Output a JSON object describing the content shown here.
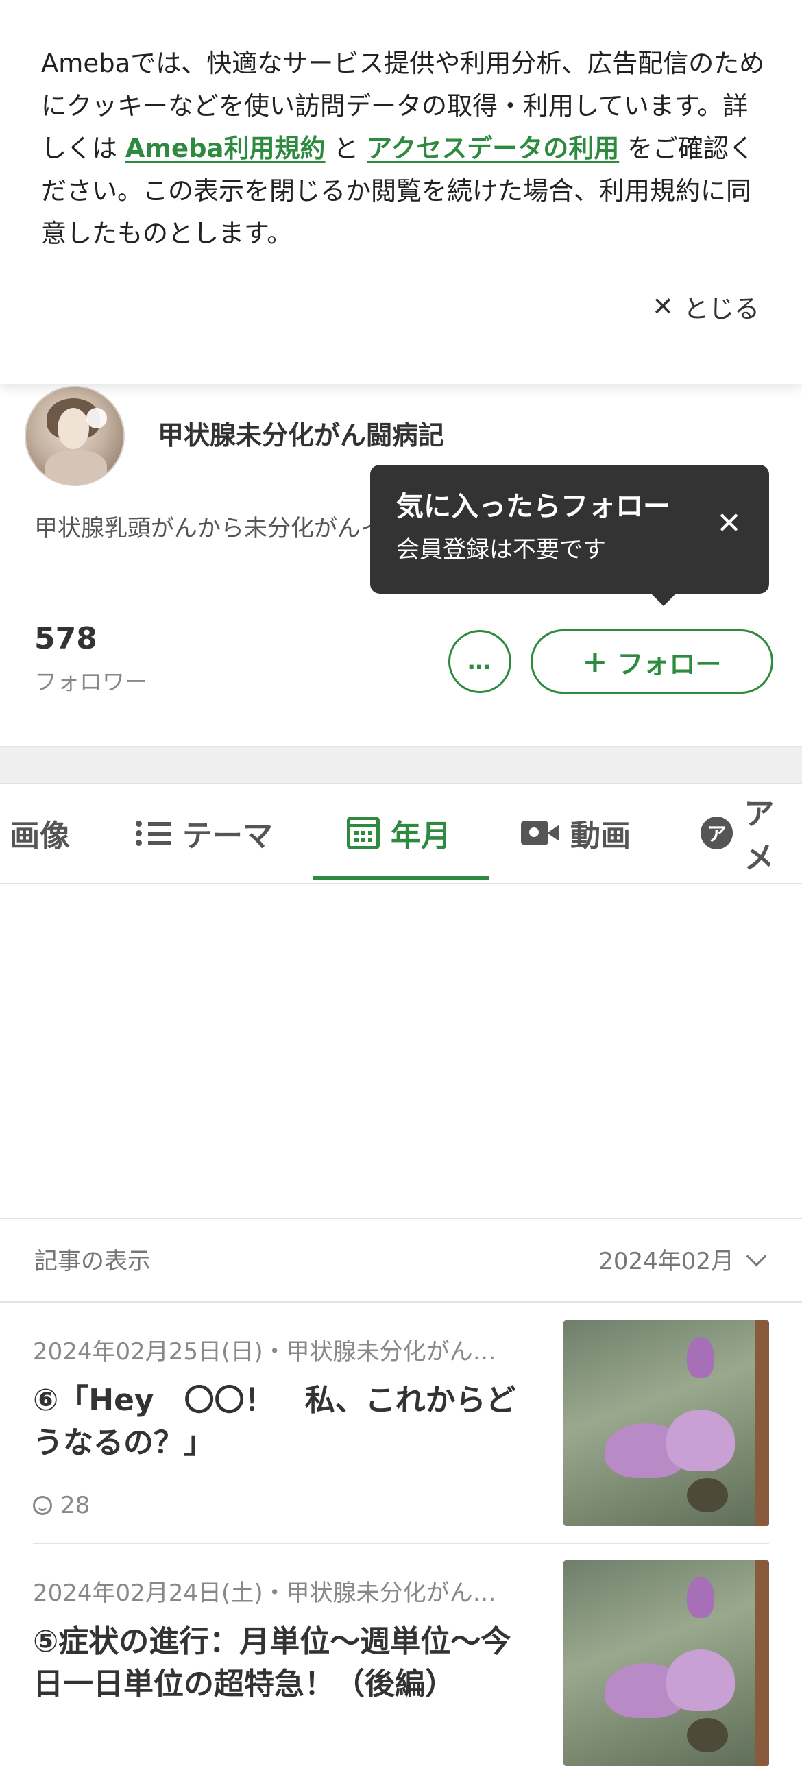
{
  "cookie_banner": {
    "text_part1": "Amebaでは、快適なサービス提供や利用分析、広告配信のためにクッキーなどを使い訪問データの取得・利用しています。詳しくは ",
    "link1": "Ameba利用規約",
    "text_mid": " と ",
    "link2": "アクセスデータの利用",
    "text_part2": " をご確認ください。この表示を閉じるか閲覧を続けた場合、利用規約に同意したものとします。",
    "close_label": "とじる"
  },
  "profile": {
    "blog_title": "甲状腺未分化がん闘病記",
    "description": "甲状腺乳頭がんから未分化がんイバーのリアルながん情報を生",
    "follower_count": "578",
    "follower_label": "フォロワー",
    "more_label": "…",
    "follow_label": "フォロー"
  },
  "tooltip": {
    "title": "気に入ったらフォロー",
    "subtitle": "会員登録は不要です"
  },
  "tabs": [
    {
      "label": "画像",
      "icon": "image-icon"
    },
    {
      "label": "テーマ",
      "icon": "list-icon"
    },
    {
      "label": "年月",
      "icon": "calendar-icon"
    },
    {
      "label": "動画",
      "icon": "video-icon"
    },
    {
      "label": "アメ",
      "icon": "ame-icon"
    }
  ],
  "article_selector": {
    "label": "記事の表示",
    "value": "2024年02月"
  },
  "articles": [
    {
      "meta": "2024年02月25日(日)・甲状腺未分化がん…",
      "title": "⑥「Hey　〇〇！　私、これからどうなるの？」",
      "likes": "28"
    },
    {
      "meta": "2024年02月24日(土)・甲状腺未分化がん…",
      "title": "⑤症状の進行：月単位〜週単位〜今日一日単位の超特急！（後編）"
    }
  ],
  "colors": {
    "accent": "#2d8a3e",
    "tooltip_bg": "#333333"
  }
}
